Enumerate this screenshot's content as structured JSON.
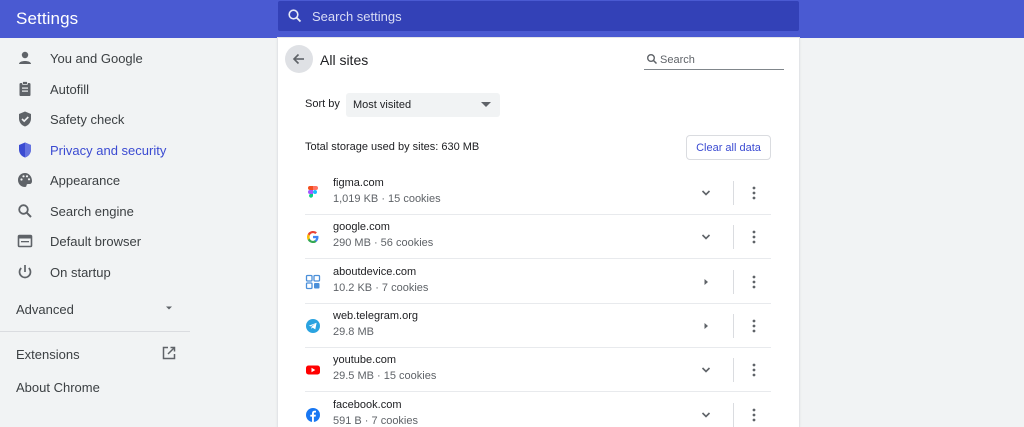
{
  "header": {
    "title": "Settings",
    "search_placeholder": "Search settings"
  },
  "sidebar": {
    "items": [
      {
        "label": "You and Google",
        "icon": "person-icon"
      },
      {
        "label": "Autofill",
        "icon": "clipboard-icon"
      },
      {
        "label": "Safety check",
        "icon": "shield-check-icon"
      },
      {
        "label": "Privacy and security",
        "icon": "shield-lock-icon",
        "active": true
      },
      {
        "label": "Appearance",
        "icon": "palette-icon"
      },
      {
        "label": "Search engine",
        "icon": "search-icon"
      },
      {
        "label": "Default browser",
        "icon": "browser-window-icon"
      },
      {
        "label": "On startup",
        "icon": "power-icon"
      }
    ],
    "advanced_label": "Advanced",
    "extensions_label": "Extensions",
    "about_label": "About Chrome"
  },
  "main": {
    "title": "All sites",
    "search_placeholder": "Search",
    "sort_label": "Sort by",
    "sort_value": "Most visited",
    "storage_text": "Total storage used by sites: 630 MB",
    "clear_all_label": "Clear all data",
    "sites": [
      {
        "origin": "figma.com",
        "meta": "1,019 KB · 15 cookies",
        "expand": "chevron-down-icon",
        "favicon": "figma-icon"
      },
      {
        "origin": "google.com",
        "meta": "290 MB · 56 cookies",
        "expand": "chevron-down-icon",
        "favicon": "google-icon"
      },
      {
        "origin": "aboutdevice.com",
        "meta": "10.2 KB · 7 cookies",
        "expand": "arrow-right-icon",
        "favicon": "aboutdevice-icon"
      },
      {
        "origin": "web.telegram.org",
        "meta": "29.8 MB",
        "expand": "arrow-right-icon",
        "favicon": "telegram-icon"
      },
      {
        "origin": "youtube.com",
        "meta": "29.5 MB · 15 cookies",
        "expand": "chevron-down-icon",
        "favicon": "youtube-icon"
      },
      {
        "origin": "facebook.com",
        "meta": "591 B · 7 cookies",
        "expand": "chevron-down-icon",
        "favicon": "facebook-icon"
      }
    ]
  },
  "colors": {
    "header": "#4a5ad2",
    "search_bg": "#3341b7",
    "accent": "#3b4bd2",
    "sidebar_bg": "#f1f3f4"
  }
}
